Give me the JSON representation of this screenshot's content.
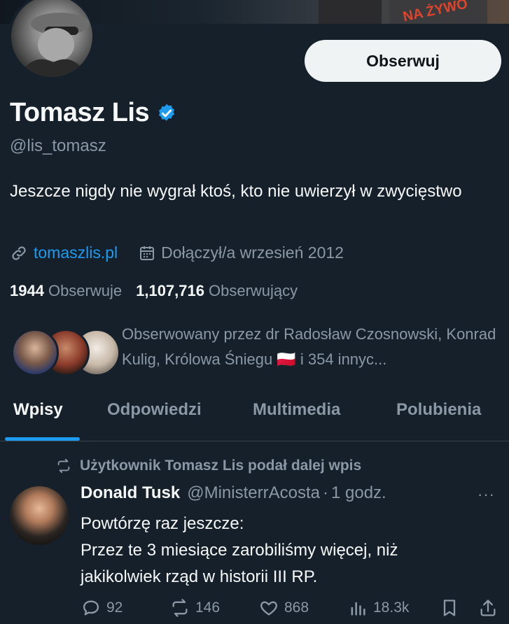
{
  "banner": {
    "overlay_text": "NA ŻYWO"
  },
  "profile": {
    "name": "Tomasz Lis",
    "handle": "@lis_tomasz",
    "bio": "Jeszcze nigdy nie wygrał ktoś, kto nie uwierzył w zwycięstwo",
    "website": "tomaszlis.pl",
    "joined": "Dołączył/a wrzesień 2012",
    "following_count": "1944",
    "following_label": "Obserwuje",
    "followers_count": "1,107,716",
    "followers_label": "Obserwujący",
    "followed_by_text": "Obserwowany przez dr Radosław Czosnowski, Konrad Kulig, Królowa Śniegu 🇵🇱 i 354 innyc...",
    "follow_button": "Obserwuj",
    "accent_color": "#1d9bf0"
  },
  "tabs": [
    {
      "label": "Wpisy",
      "active": true
    },
    {
      "label": "Odpowiedzi",
      "active": false
    },
    {
      "label": "Multimedia",
      "active": false
    },
    {
      "label": "Polubienia",
      "active": false
    }
  ],
  "post": {
    "repost_text": "Użytkownik Tomasz Lis podał dalej wpis",
    "author_name": "Donald Tusk",
    "author_handle": "@MinisterrAcosta",
    "separator": "·",
    "time": "1 godz.",
    "more": "···",
    "lines": [
      "Powtórzę raz jeszcze:",
      "Przez te 3 miesiące zarobiliśmy więcej, niż",
      "jakikolwiek rząd w historii III RP."
    ],
    "replies": "92",
    "reposts": "146",
    "likes": "868",
    "views": "18.3k"
  },
  "icons": {
    "verified": "verified-badge-icon",
    "link": "link-icon",
    "calendar": "calendar-icon",
    "repost": "repost-icon",
    "reply": "reply-icon",
    "like": "heart-icon",
    "views": "views-icon",
    "bookmark": "bookmark-icon",
    "share": "share-icon"
  }
}
